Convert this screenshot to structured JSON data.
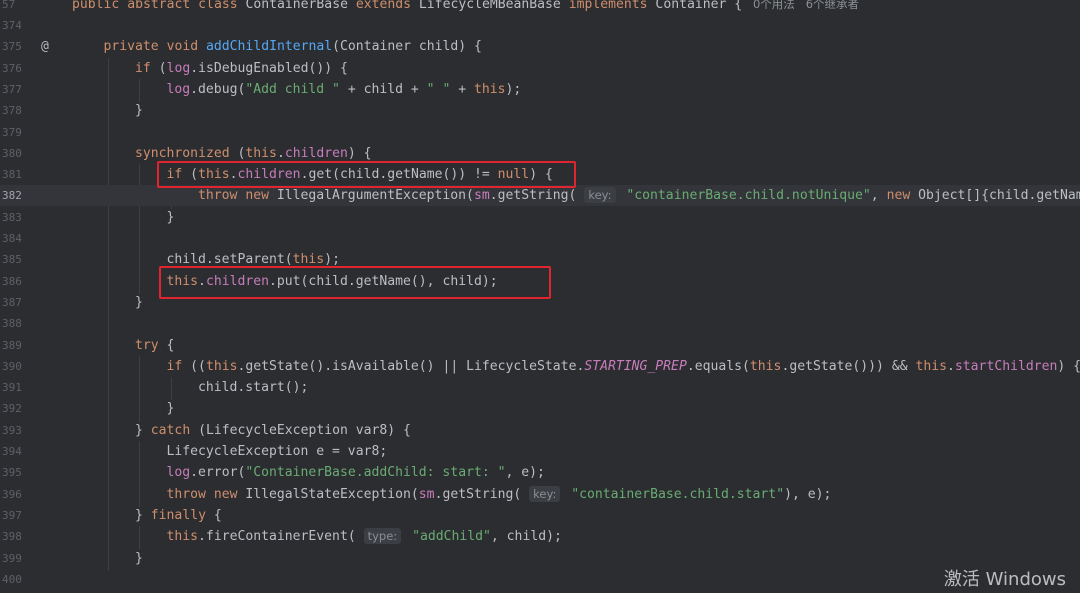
{
  "editor": {
    "header": {
      "line_number": "57",
      "code": "public abstract class ContainerBase extends LifecycleMBeanBase implements Container {",
      "usages": "0个用法",
      "inheritors": "6个继承者"
    },
    "lines": [
      {
        "num": "374",
        "code": ""
      },
      {
        "num": "375",
        "code": "private void addChildInternal(Container child) {"
      },
      {
        "num": "376",
        "code": "if (log.isDebugEnabled()) {"
      },
      {
        "num": "377",
        "code": "log.debug(\"Add child \" + child + \" \" + this);"
      },
      {
        "num": "378",
        "code": "}"
      },
      {
        "num": "379",
        "code": ""
      },
      {
        "num": "380",
        "code": "synchronized (this.children) {"
      },
      {
        "num": "381",
        "code": "if (this.children.get(child.getName()) != null) {"
      },
      {
        "num": "382",
        "code": "throw new IllegalArgumentException(sm.getString( key: \"containerBase.child.notUnique\", new Object[]{child.getName()"
      },
      {
        "num": "383",
        "code": "}"
      },
      {
        "num": "384",
        "code": ""
      },
      {
        "num": "385",
        "code": "child.setParent(this);"
      },
      {
        "num": "386",
        "code": "this.children.put(child.getName(), child);"
      },
      {
        "num": "387",
        "code": "}"
      },
      {
        "num": "388",
        "code": ""
      },
      {
        "num": "389",
        "code": "try {"
      },
      {
        "num": "390",
        "code": "if ((this.getState().isAvailable() || LifecycleState.STARTING_PREP.equals(this.getState())) && this.startChildren) {"
      },
      {
        "num": "391",
        "code": "child.start();"
      },
      {
        "num": "392",
        "code": "}"
      },
      {
        "num": "393",
        "code": "} catch (LifecycleException var8) {"
      },
      {
        "num": "394",
        "code": "LifecycleException e = var8;"
      },
      {
        "num": "395",
        "code": "log.error(\"ContainerBase.addChild: start: \", e);"
      },
      {
        "num": "396",
        "code": "throw new IllegalStateException(sm.getString( key: \"containerBase.child.start\"), e);"
      },
      {
        "num": "397",
        "code": "} finally {"
      },
      {
        "num": "398",
        "code": "this.fireContainerEvent( type: \"addChild\", child);"
      },
      {
        "num": "399",
        "code": "}"
      },
      {
        "num": "400",
        "code": ""
      }
    ],
    "override_marker": "@",
    "current_line": "382"
  },
  "watermark": "激活 Windows",
  "colors": {
    "background": "#2b2d30",
    "keyword": "#cf8e6d",
    "method": "#56a8f5",
    "field": "#c77dbb",
    "string": "#6aab73",
    "highlight_box": "#e0252f"
  }
}
